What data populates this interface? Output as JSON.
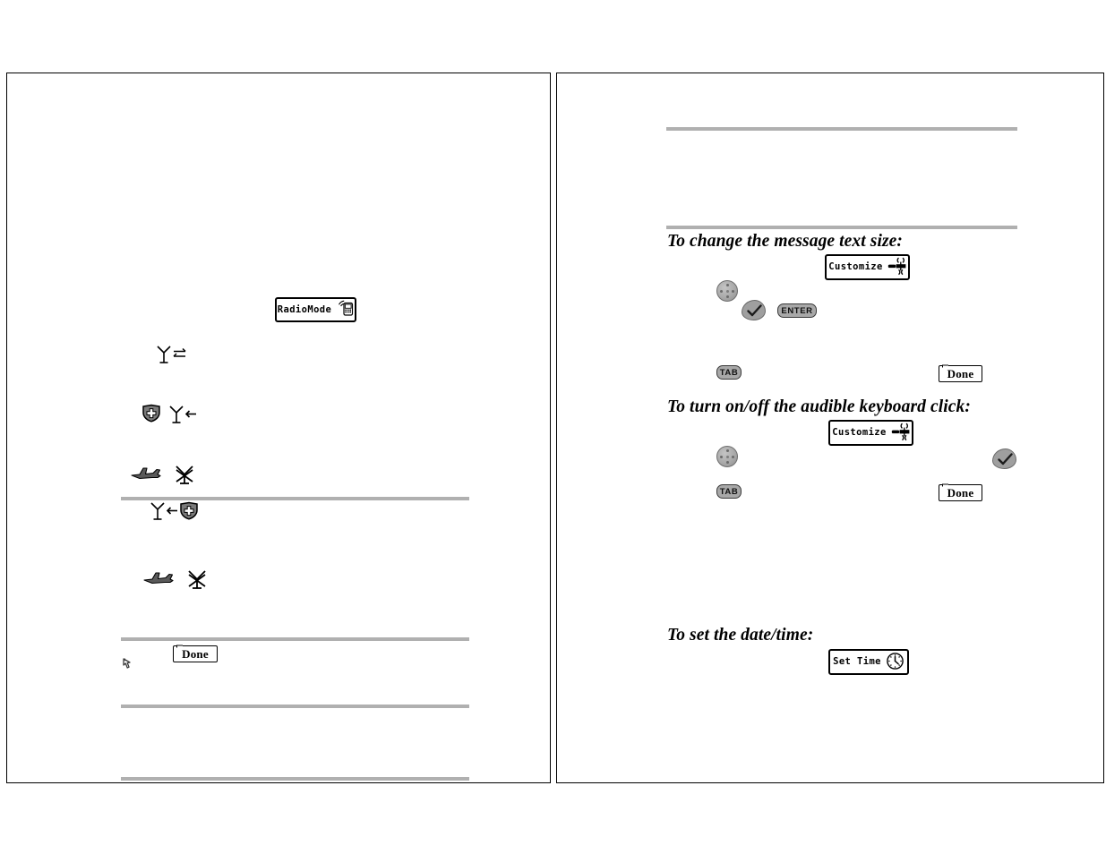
{
  "document": {
    "kind": "two-page-manual-spread",
    "background_color": "#ffffff",
    "rule_color": "#b0b0b0",
    "ink_color": "#000000"
  },
  "left_page": {
    "buttons": [
      {
        "id": "radiomode",
        "label": "RadioMode",
        "icon": "handset-radio-waves-icon"
      },
      {
        "id": "done",
        "label": "Done",
        "icon": "none"
      }
    ],
    "status_icons": [
      {
        "id": "antenna-send-receive",
        "name": "antenna-two-way-arrows-icon",
        "glyph": "antenna + bidirectional arrows"
      },
      {
        "id": "shield-plus",
        "name": "shield-plus-icon",
        "glyph": "filled shield with plus"
      },
      {
        "id": "antenna-receive",
        "name": "antenna-left-arrow-icon",
        "glyph": "antenna + left arrow"
      },
      {
        "id": "airplane",
        "name": "airplane-icon",
        "glyph": "side-view airplane"
      },
      {
        "id": "antenna-off",
        "name": "antenna-crossed-out-icon",
        "glyph": "antenna with X through it"
      },
      {
        "id": "antenna-to-shield",
        "name": "antenna-left-arrow-shield-icon",
        "glyph": "antenna + left arrow + shield"
      }
    ],
    "cursor": {
      "name": "hand-pointer-cursor-icon"
    },
    "rules_count": 4
  },
  "right_page": {
    "headings": [
      {
        "id": "h-text-size",
        "text": "To change the message text size:"
      },
      {
        "id": "h-keyboard-click",
        "text": "To turn on/off the audible keyboard click:"
      },
      {
        "id": "h-date-time",
        "text": "To set the date/time:"
      }
    ],
    "buttons": [
      {
        "id": "customize-1",
        "label": "Customize",
        "icon": "wrench-screwdriver-icon"
      },
      {
        "id": "customize-2",
        "label": "Customize",
        "icon": "wrench-screwdriver-icon"
      },
      {
        "id": "set-time",
        "label": "Set Time",
        "icon": "clock-icon"
      },
      {
        "id": "done-1",
        "label": "Done",
        "icon": "none"
      },
      {
        "id": "done-2",
        "label": "Done",
        "icon": "none"
      }
    ],
    "keys": [
      {
        "id": "enter-1",
        "label": "ENTER",
        "name": "enter-key"
      },
      {
        "id": "tab-1",
        "label": "TAB",
        "name": "tab-key"
      },
      {
        "id": "tab-2",
        "label": "TAB",
        "name": "tab-key"
      }
    ],
    "nav_controls": [
      {
        "id": "trackpad-1",
        "name": "trackpad-nav-disc"
      },
      {
        "id": "trackpad-2",
        "name": "trackpad-nav-disc"
      },
      {
        "id": "checkkey-1",
        "name": "check-confirm-key"
      },
      {
        "id": "checkkey-2",
        "name": "check-confirm-key"
      }
    ],
    "rules_count": 3
  }
}
